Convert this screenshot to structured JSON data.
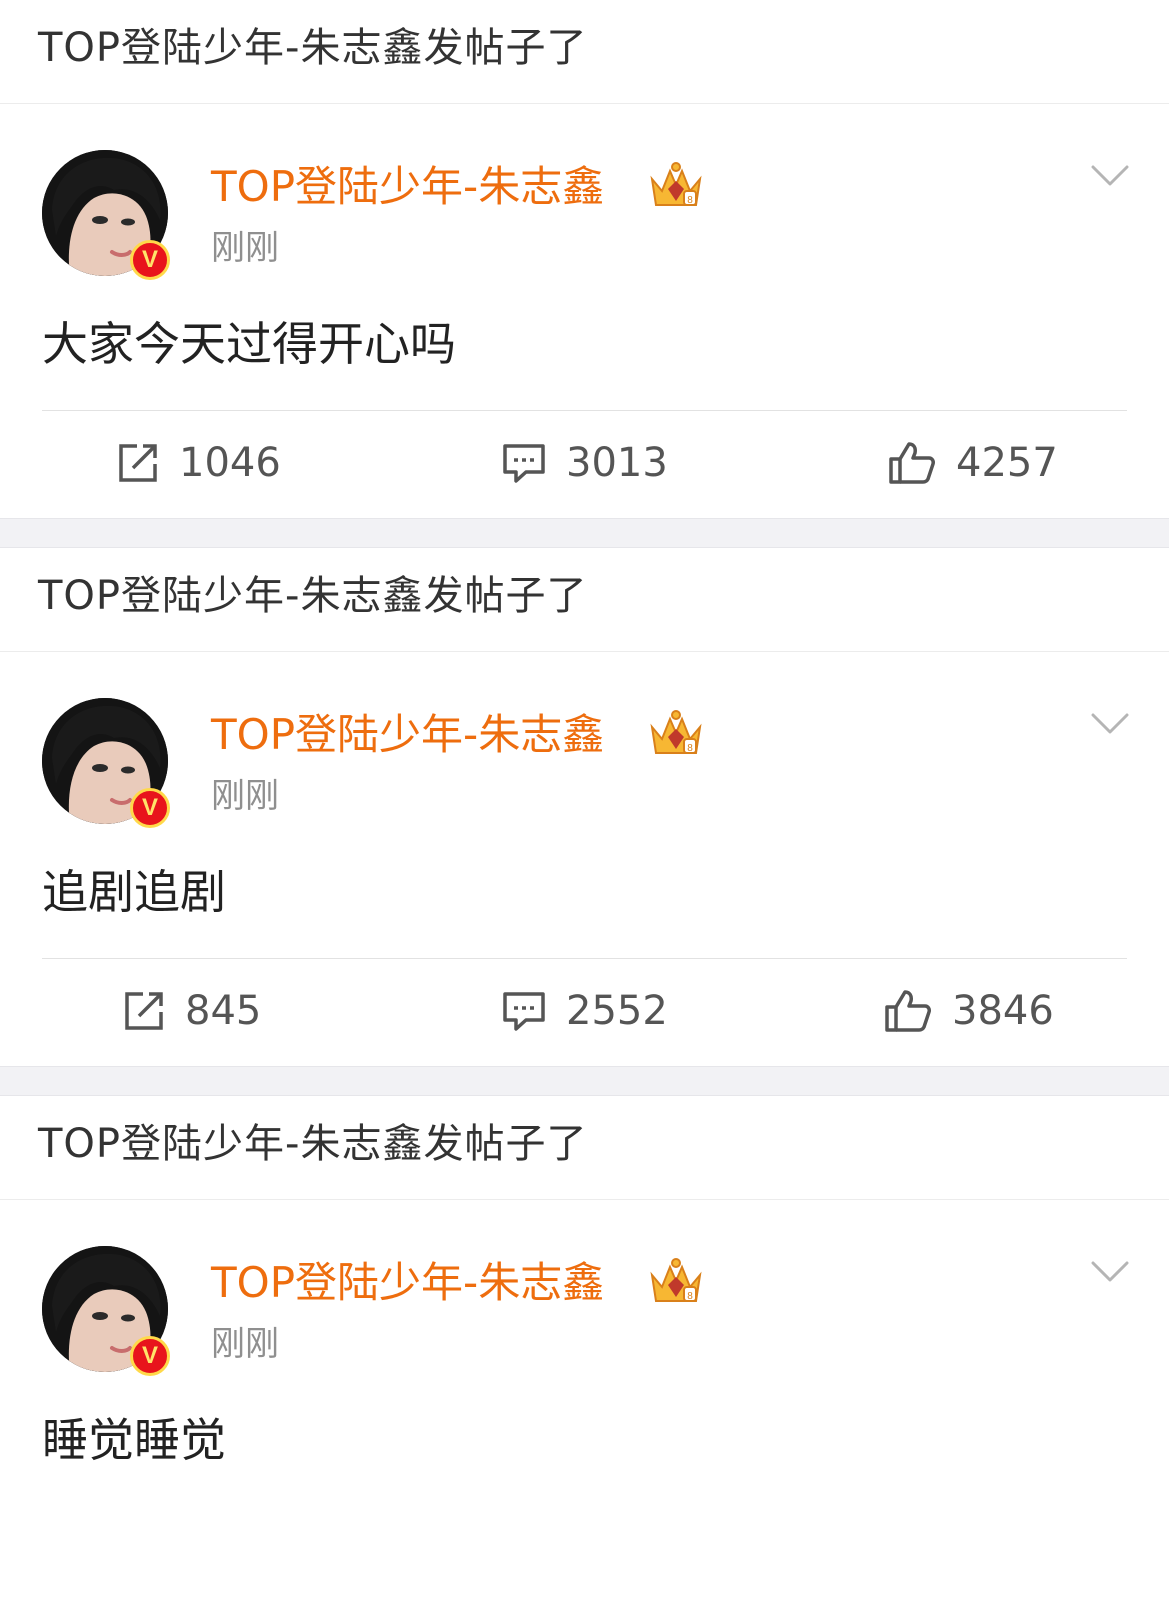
{
  "brand": {
    "username_color": "#ee6d0e",
    "verified_color": "#e8141c"
  },
  "posts": [
    {
      "notice": "TOP登陆少年-朱志鑫发帖子了",
      "username": "TOP登陆少年-朱志鑫",
      "time": "刚刚",
      "content": "大家今天过得开心吗",
      "reposts": "1046",
      "comments": "3013",
      "likes": "4257"
    },
    {
      "notice": "TOP登陆少年-朱志鑫发帖子了",
      "username": "TOP登陆少年-朱志鑫",
      "time": "刚刚",
      "content": "追剧追剧",
      "reposts": "845",
      "comments": "2552",
      "likes": "3846"
    },
    {
      "notice": "TOP登陆少年-朱志鑫发帖子了",
      "username": "TOP登陆少年-朱志鑫",
      "time": "刚刚",
      "content": "睡觉睡觉"
    }
  ],
  "icons": {
    "verified": "v-badge",
    "member_crown": "crown-icon",
    "menu": "chevron-down-icon",
    "repost": "repost-icon",
    "comment": "comment-icon",
    "like": "thumbs-up-icon"
  }
}
